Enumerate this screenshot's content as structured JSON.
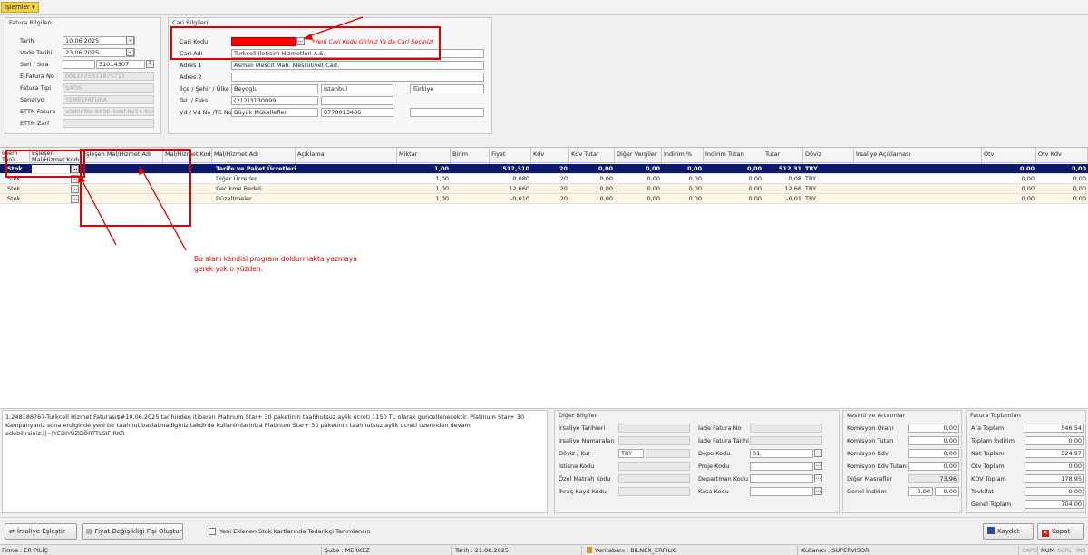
{
  "menu": {
    "label": "İşlemler ▾"
  },
  "fatura_bilgileri": {
    "title": "Fatura Bilgileri",
    "tarih_label": "Tarih",
    "tarih": "10.06.2025",
    "vade_label": "Vade Tarihi",
    "vade": "23.06.2025",
    "seri_label": "Seri / Sıra",
    "seri": "",
    "sira": "31014307",
    "efatura_label": "E-Fatura No",
    "efatura": "0012025311875711",
    "tipi_label": "Fatura Tipi",
    "tipi": "SATIS",
    "senaryo_label": "Senaryo",
    "senaryo": "TEMELFATURA",
    "ettn_label": "ETTN Fatura",
    "ettn": "a0d0ef8e-b83b-4ebf-8e14-6c4b",
    "ettn_zarf_label": "ETTN Zarf",
    "ettn_zarf": ""
  },
  "cari_bilgileri": {
    "title": "Cari Bilgileri",
    "kod_label": "Cari Kodu",
    "kod": "",
    "warning": "*Yeni Cari Kodu Giriniz Ya da Cari Seçiniz!",
    "adi_label": "Cari Adı",
    "adi": "Turkcell Iletisim Hizmetleri A.S.",
    "adres1_label": "Adres 1",
    "adres1": "Asmali Mescit Mah. Mesrutiyet Cad.",
    "adres2_label": "Adres 2",
    "adres2": "",
    "ilce_label": "İlçe / Şehir / Ülke",
    "ilce": "Beyoglu",
    "sehir": "Istanbul",
    "ulke": "Türkiye",
    "tel_label": "Tel. / Faks",
    "tel": "(212)3130099",
    "faks": "",
    "vd_label": "Vd / Vd No /TC No",
    "vd": "Büyük Mükellefler",
    "vdno": "8770013406",
    "tcno": ""
  },
  "grid": {
    "headers": {
      "islem": "İşlem\nTürü",
      "eslesen": "Eşleşen\nMal/Hizmet Kodu",
      "eslesen_adi": "Eşleşen Mal/Hizmet Adı",
      "mh_kodu": "Mal/Hizmet Kodu",
      "mh_adi": "Mal/Hizmet Adı",
      "aciklama": "Açıklama",
      "miktar": "Miktar",
      "birim": "Birim",
      "fiyat": "Fiyat",
      "kdv": "Kdv",
      "kdv_tutar": "Kdv Tutar",
      "diger": "Diğer Vergiler",
      "indirim_y": "İndirim %",
      "indirim_t": "İndirim Tutarı",
      "tutar": "Tutar",
      "doviz": "Döviz",
      "irsaliye": "İrsaliye Açıklaması",
      "otv": "Ötv",
      "otv_kdv": "Ötv Kdv"
    },
    "rows": [
      {
        "islem": "Stok",
        "adi": "Tarife ve Paket Ücretleri",
        "miktar": "1,00",
        "fiyat": "512,310",
        "kdv": "20",
        "kdv_tutar": "0,00",
        "diger": "0,00",
        "indirim_y": "0,00",
        "indirim_t": "0,00",
        "tutar": "512,31",
        "doviz": "TRY",
        "otv": "0,00",
        "otv_kdv": "0,00"
      },
      {
        "islem": "Stok",
        "adi": "Diğer Ücretler",
        "miktar": "1,00",
        "fiyat": "0,080",
        "kdv": "20",
        "kdv_tutar": "0,00",
        "diger": "0,00",
        "indirim_y": "0,00",
        "indirim_t": "0,00",
        "tutar": "0,08",
        "doviz": "TRY",
        "otv": "0,00",
        "otv_kdv": "0,00"
      },
      {
        "islem": "Stok",
        "adi": "Gecikme Bedeli",
        "miktar": "1,00",
        "fiyat": "12,660",
        "kdv": "20",
        "kdv_tutar": "0,00",
        "diger": "0,00",
        "indirim_y": "0,00",
        "indirim_t": "0,00",
        "tutar": "12,66",
        "doviz": "TRY",
        "otv": "0,00",
        "otv_kdv": "0,00"
      },
      {
        "islem": "Stok",
        "adi": "Düzeltmeler",
        "miktar": "1,00",
        "fiyat": "-0,010",
        "kdv": "20",
        "kdv_tutar": "0,00",
        "diger": "0,00",
        "indirim_y": "0,00",
        "indirim_t": "0,00",
        "tutar": "-0,01",
        "doviz": "TRY",
        "otv": "0,00",
        "otv_kdv": "0,00"
      }
    ]
  },
  "annotation": "Bu alanı kendisi program doldurmakta yazmaya\ngerek yok o yüzden.",
  "notes": "1.248188767-Turkcell Hizmet Faturası$#10.06.2025 tarihinden itibaren Platinum Star+ 30  paketinin taahhutsuz aylik ucreti 1150 TL olarak guncellenecektir. Platinum Star+ 30  Kampanyaniz sona erdiginde yeni bir taahhut baslatmadiginiz takdirde kullanimlariniza Platinum Star+ 30  paketinin taahhutsuz aylik ucreti uzerinden devam edebilirsiniz.||~|YEDIYÜZDÖRTTLSIFIRKR",
  "diger_bilgiler": {
    "title": "Diğer Bilgiler",
    "irs_tarih": "İrsaliye Tarihleri",
    "irs_no": "İrsaliye Numaraları",
    "doviz_kur": "Döviz / Kur",
    "doviz_val": "TRY",
    "istisna": "İstisna Kodu",
    "ozel": "Özel Matrah Kodu",
    "ihrac": "İhraç Kayıt Kodu",
    "iade_no": "İade Fatura No",
    "iade_tarih": "İade Fatura Tarihi",
    "depo": "Depo Kodu",
    "depo_val": "01",
    "proje": "Proje Kodu",
    "departman": "Departman Kodu",
    "kasa": "Kasa Kodu"
  },
  "kesinti": {
    "title": "Kesinti ve Artırımlar",
    "kom_oran": "Komisyon Oranı",
    "kom_oran_v": "0,00",
    "kom_tutar": "Komisyon Tutarı",
    "kom_tutar_v": "0,00",
    "kom_kdv": "Komisyon Kdv",
    "kom_kdv_v": "0,00",
    "kom_kdv_t": "Komisyon Kdv Tutarı",
    "kom_kdv_t_v": "0,00",
    "diger_mas": "Diğer Masraflar",
    "diger_mas_v": "73,96",
    "genel_ind": "Genel İndirim",
    "genel_ind_v1": "0,00",
    "genel_ind_v2": "0,00"
  },
  "toplamlar": {
    "title": "Fatura Toplamları",
    "ara": "Ara Toplam",
    "ara_v": "546,54",
    "indirim": "Toplam İndirim",
    "indirim_v": "0,00",
    "net": "Net Toplam",
    "net_v": "524,97",
    "otv": "Ötv Toplam",
    "otv_v": "0,00",
    "kdv": "KDV Toplam",
    "kdv_v": "178,95",
    "tevkifat": "Tevkifat",
    "tevkifat_v": "0,00",
    "genel": "Genel Toplam",
    "genel_v": "704,00"
  },
  "actions": {
    "irsaliye": "İrsaliye Eşleştir",
    "fiyat": "Fiyat Değişikliği Fişi Oluştur",
    "checkbox": "Yeni Eklenen Stok Kartlarında Tedarikçi Tanımlansın",
    "kaydet": "Kaydet",
    "kapat": "Kapat"
  },
  "status": {
    "firma": "Firma : ER PİLİÇ",
    "sube": "Şube : MERKEZ",
    "tarih": "Tarih : 21.08.2025",
    "veritabani": "Veritabanı : BILNEX_ERPILIC",
    "kullanici": "Kullanıcı : SUPERVISOR",
    "caps": "CAPS",
    "num": "NUM",
    "scrl": "SCRL",
    "ins": "INS"
  },
  "colors": {
    "accent": "#0c1a6e",
    "warning": "#e00000",
    "menu": "#f5d34a"
  }
}
